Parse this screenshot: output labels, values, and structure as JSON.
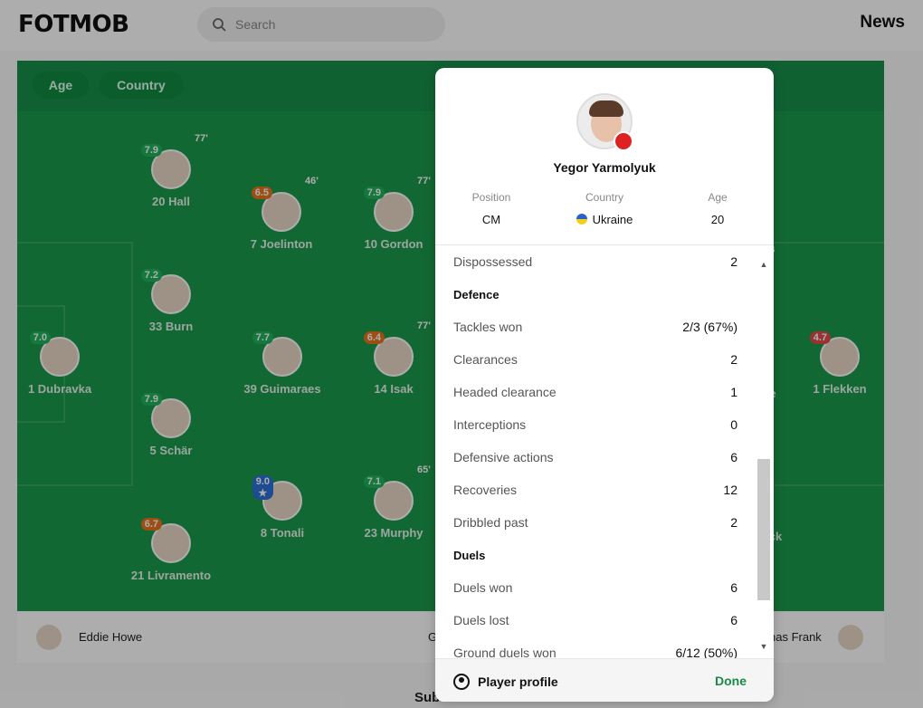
{
  "header": {
    "logo": "FOTMOB",
    "search_placeholder": "Search",
    "news": "News"
  },
  "pitch": {
    "filters": [
      "Age",
      "Country"
    ]
  },
  "players": [
    {
      "label": "20 Hall",
      "rating": "7.9",
      "minute": "77'"
    },
    {
      "label": "7 Joelinton",
      "rating": "6.5",
      "minute": "46'"
    },
    {
      "label": "10 Gordon",
      "rating": "7.9",
      "minute": "77'"
    },
    {
      "label": "33 Burn",
      "rating": "7.2"
    },
    {
      "label": "1 Dubravka",
      "rating": "7.0"
    },
    {
      "label": "39 Guimaraes",
      "rating": "7.7"
    },
    {
      "label": "14 Isak",
      "rating": "6.4",
      "minute": "77'"
    },
    {
      "label": "5 Schär",
      "rating": "7.9"
    },
    {
      "label": "8 Tonali",
      "rating": "9.0 ★"
    },
    {
      "label": "23 Murphy",
      "rating": "7.1",
      "minute": "65'"
    },
    {
      "label": "21 Livramento",
      "rating": "6.7"
    },
    {
      "label": "1 Flekken",
      "rating": "4.7"
    }
  ],
  "partial_labels": {
    "right_ns": "ns",
    "right_e": "e",
    "right_ck": "ck",
    "coach_left_g": "G",
    "coach_right": "nas Frank",
    "subs": "Sub"
  },
  "coaches": {
    "home": "Eddie Howe"
  },
  "modal": {
    "player_name": "Yegor Yarmolyuk",
    "position_label": "Position",
    "position_value": "CM",
    "country_label": "Country",
    "country_value": "Ukraine",
    "age_label": "Age",
    "age_value": "20",
    "stats": [
      {
        "label": "Dispossessed",
        "value": "2"
      },
      {
        "section": "Defence"
      },
      {
        "label": "Tackles won",
        "value": "2/3 (67%)"
      },
      {
        "label": "Clearances",
        "value": "2"
      },
      {
        "label": "Headed clearance",
        "value": "1"
      },
      {
        "label": "Interceptions",
        "value": "0"
      },
      {
        "label": "Defensive actions",
        "value": "6"
      },
      {
        "label": "Recoveries",
        "value": "12"
      },
      {
        "label": "Dribbled past",
        "value": "2"
      },
      {
        "section": "Duels"
      },
      {
        "label": "Duels won",
        "value": "6"
      },
      {
        "label": "Duels lost",
        "value": "6"
      },
      {
        "label": "Ground duels won",
        "value": "6/12 (50%)"
      }
    ],
    "footer": {
      "profile": "Player profile",
      "done": "Done"
    }
  }
}
